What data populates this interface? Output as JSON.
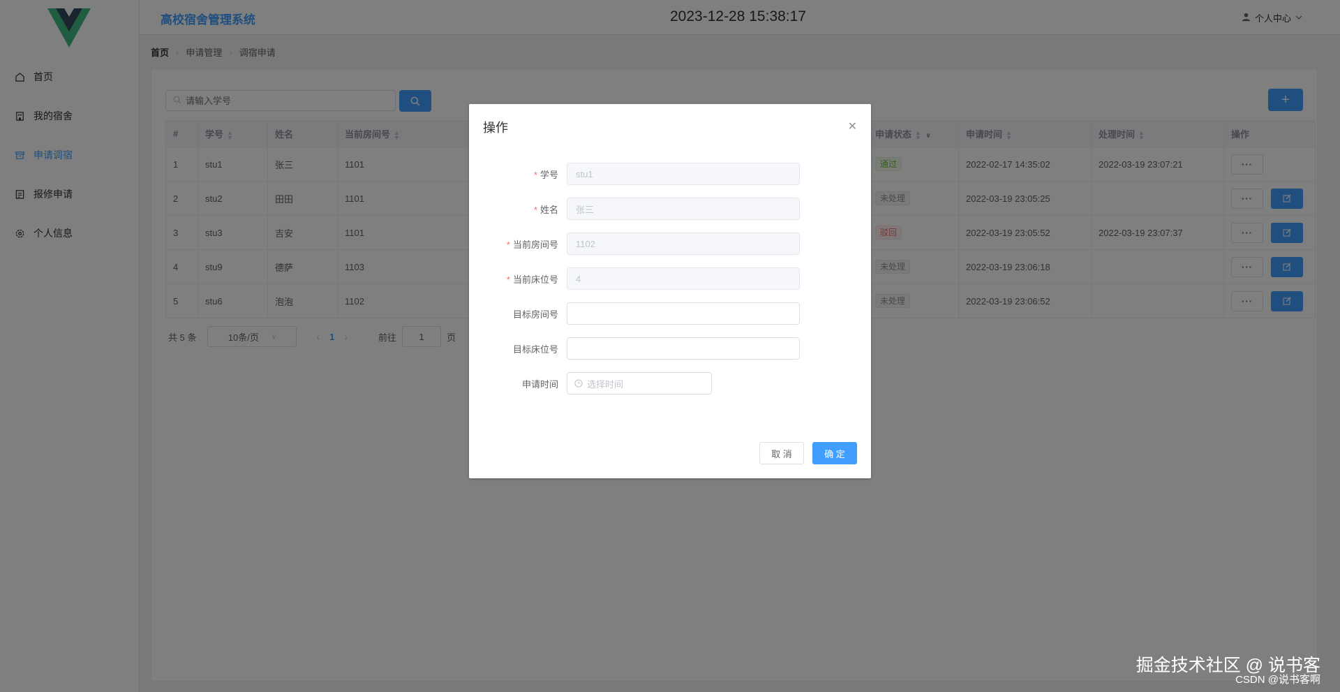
{
  "header": {
    "app_title": "高校宿舍管理系统",
    "datetime": "2023-12-28 15:38:17",
    "user_center": "个人中心"
  },
  "sidebar": {
    "items": [
      {
        "label": "首页",
        "icon": "home-icon",
        "active": false
      },
      {
        "label": "我的宿舍",
        "icon": "building-icon",
        "active": false
      },
      {
        "label": "申请调宿",
        "icon": "archive-icon",
        "active": true
      },
      {
        "label": "报修申请",
        "icon": "repair-form-icon",
        "active": false
      },
      {
        "label": "个人信息",
        "icon": "gear-icon",
        "active": false
      }
    ]
  },
  "breadcrumb": [
    "首页",
    "申请管理",
    "调宿申请"
  ],
  "search": {
    "placeholder": "请输入学号"
  },
  "add_label": "+",
  "table": {
    "columns": [
      "#",
      "学号",
      "姓名",
      "当前房间号",
      "申请状态",
      "申请时间",
      "处理时间",
      "操作"
    ],
    "rows": [
      {
        "idx": "1",
        "sid": "stu1",
        "name": "张三",
        "room": "1101",
        "status": "通过",
        "status_kind": "pass",
        "apply_time": "2022-02-17 14:35:02",
        "handle_time": "2022-03-19 23:07:21",
        "editable": false
      },
      {
        "idx": "2",
        "sid": "stu2",
        "name": "田田",
        "room": "1101",
        "status": "未处理",
        "status_kind": "pending",
        "apply_time": "2022-03-19 23:05:25",
        "handle_time": "",
        "editable": true
      },
      {
        "idx": "3",
        "sid": "stu3",
        "name": "吉安",
        "room": "1101",
        "status": "驳回",
        "status_kind": "reject",
        "apply_time": "2022-03-19 23:05:52",
        "handle_time": "2022-03-19 23:07:37",
        "editable": true
      },
      {
        "idx": "4",
        "sid": "stu9",
        "name": "德萨",
        "room": "1103",
        "status": "未处理",
        "status_kind": "pending",
        "apply_time": "2022-03-19 23:06:18",
        "handle_time": "",
        "editable": true
      },
      {
        "idx": "5",
        "sid": "stu6",
        "name": "泡泡",
        "room": "1102",
        "status": "未处理",
        "status_kind": "pending",
        "apply_time": "2022-03-19 23:06:52",
        "handle_time": "",
        "editable": true
      }
    ],
    "more_label": "···"
  },
  "pagination": {
    "total": "共 5 条",
    "page_size": "10条/页",
    "current_page": "1",
    "goto_label": "前往",
    "goto_value": "1",
    "page_suffix": "页"
  },
  "dialog": {
    "title": "操作",
    "fields": [
      {
        "label": "学号",
        "required": true,
        "value": "stu1",
        "disabled": true
      },
      {
        "label": "姓名",
        "required": true,
        "value": "张三",
        "disabled": true
      },
      {
        "label": "当前房间号",
        "required": true,
        "value": "1102",
        "disabled": true
      },
      {
        "label": "当前床位号",
        "required": true,
        "value": "4",
        "disabled": true
      },
      {
        "label": "目标房间号",
        "required": false,
        "value": "",
        "disabled": false
      },
      {
        "label": "目标床位号",
        "required": false,
        "value": "",
        "disabled": false
      }
    ],
    "time_label": "申请时间",
    "time_placeholder": "选择时间",
    "cancel_label": "取 消",
    "ok_label": "确 定"
  },
  "watermark": {
    "main": "掘金技术社区 @ 说书客",
    "sub": "CSDN @说书客啊"
  },
  "colors": {
    "primary": "#409eff",
    "pass": "#67c23a",
    "reject": "#f56c6c",
    "pending": "#909399"
  }
}
